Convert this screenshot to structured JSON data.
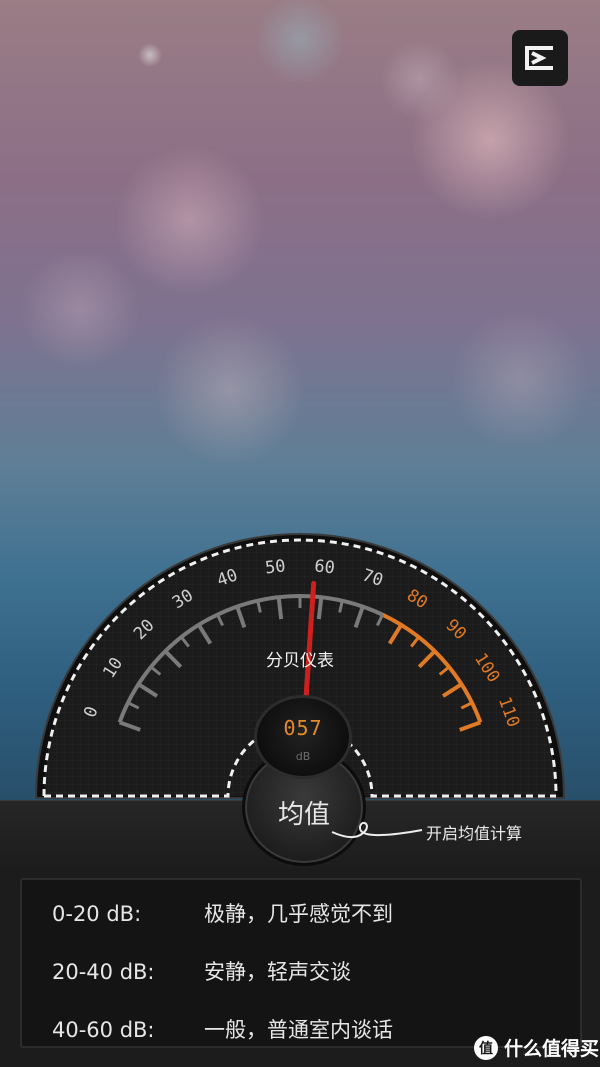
{
  "gauge": {
    "title": "分贝仪表",
    "reading": "057",
    "unit": "dB",
    "needle_value": 58,
    "ticks_gray": [
      "0",
      "10",
      "20",
      "30",
      "40",
      "50",
      "60",
      "70"
    ],
    "ticks_orange": [
      "80",
      "90",
      "100",
      "110"
    ],
    "colors": {
      "gray": "#7a7a7a",
      "orange": "#e07a25",
      "needle": "#d0201e"
    }
  },
  "average": {
    "label": "均值",
    "hint": "开启均值计算"
  },
  "levels": [
    {
      "range": "0-20 dB:",
      "desc": "极静，几乎感觉不到"
    },
    {
      "range": "20-40 dB:",
      "desc": "安静，轻声交谈"
    },
    {
      "range": "40-60 dB:",
      "desc": "一般，普通室内谈话"
    }
  ],
  "watermark": {
    "text": "什么值得买",
    "icon": "值"
  },
  "icons": {
    "menu": "menu-icon"
  }
}
